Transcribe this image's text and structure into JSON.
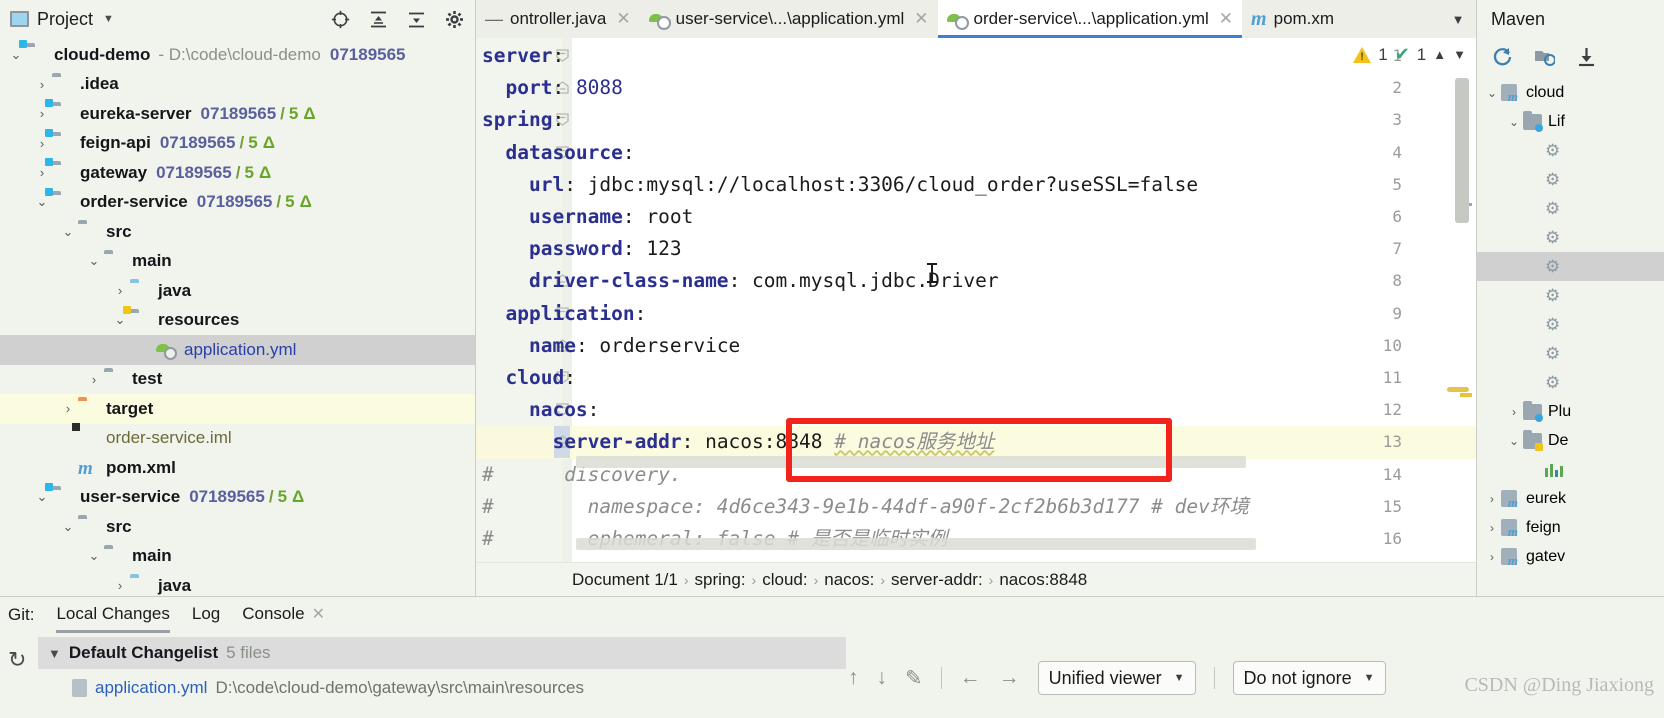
{
  "project_panel": {
    "title": "Project",
    "icons": [
      "locate-icon",
      "expand-all-icon",
      "collapse-all-icon",
      "settings-gear-icon",
      "hide-icon"
    ],
    "tree": [
      {
        "label": "cloud-demo",
        "path": "- D:\\code\\cloud-demo",
        "hash": "07189565",
        "depth": 0,
        "arrow": "expanded",
        "icon": "module-folder-icon"
      },
      {
        "label": ".idea",
        "depth": 1,
        "arrow": "collapsed",
        "icon": "folder-icon",
        "bold": false
      },
      {
        "label": "eureka-server",
        "hash": "07189565",
        "slash": "/",
        "num": "5",
        "delta": "Δ",
        "depth": 1,
        "arrow": "collapsed",
        "icon": "module-folder-icon"
      },
      {
        "label": "feign-api",
        "hash": "07189565",
        "slash": "/",
        "num": "5",
        "delta": "Δ",
        "depth": 1,
        "arrow": "collapsed",
        "icon": "module-folder-icon"
      },
      {
        "label": "gateway",
        "hash": "07189565",
        "slash": "/",
        "num": "5",
        "delta": "Δ",
        "depth": 1,
        "arrow": "collapsed",
        "icon": "module-folder-icon"
      },
      {
        "label": "order-service",
        "hash": "07189565",
        "slash": "/",
        "num": "5",
        "delta": "Δ",
        "depth": 1,
        "arrow": "expanded",
        "icon": "module-folder-icon"
      },
      {
        "label": "src",
        "depth": 2,
        "arrow": "expanded",
        "icon": "folder-icon"
      },
      {
        "label": "main",
        "depth": 3,
        "arrow": "expanded",
        "icon": "folder-icon"
      },
      {
        "label": "java",
        "depth": 4,
        "arrow": "collapsed",
        "icon": "sources-folder-icon"
      },
      {
        "label": "resources",
        "depth": 4,
        "arrow": "expanded",
        "icon": "resources-folder-icon"
      },
      {
        "label": "application.yml",
        "depth": 5,
        "arrow": "none",
        "icon": "spring-yaml-icon",
        "selected": true
      },
      {
        "label": "test",
        "depth": 3,
        "arrow": "collapsed",
        "icon": "folder-icon"
      },
      {
        "label": "target",
        "depth": 2,
        "arrow": "collapsed",
        "icon": "excluded-folder-icon",
        "modified": true
      },
      {
        "label": "order-service.iml",
        "depth": 2,
        "arrow": "none",
        "icon": "iml-file-icon"
      },
      {
        "label": "pom.xml",
        "depth": 2,
        "arrow": "none",
        "icon": "maven-pom-icon"
      },
      {
        "label": "user-service",
        "hash": "07189565",
        "slash": "/",
        "num": "5",
        "delta": "Δ",
        "depth": 1,
        "arrow": "expanded",
        "icon": "module-folder-icon"
      },
      {
        "label": "src",
        "depth": 2,
        "arrow": "expanded",
        "icon": "folder-icon"
      },
      {
        "label": "main",
        "depth": 3,
        "arrow": "expanded",
        "icon": "folder-icon"
      },
      {
        "label": "java",
        "depth": 4,
        "arrow": "collapsed",
        "icon": "sources-folder-icon"
      }
    ]
  },
  "tabs": [
    {
      "label": "ontroller.java",
      "icon": "minus-icon",
      "active": false,
      "closable": true
    },
    {
      "label": "user-service\\...\\application.yml",
      "icon": "spring-yaml-icon",
      "active": false,
      "closable": true
    },
    {
      "label": "order-service\\...\\application.yml",
      "icon": "spring-yaml-icon",
      "active": true,
      "closable": true
    },
    {
      "label": "pom.xm",
      "icon": "maven-pom-icon",
      "active": false,
      "closable": false
    }
  ],
  "tab_overflow_icon": "chevron-down-icon",
  "editor": {
    "inspections": {
      "warning_count": "1",
      "check_count": "1",
      "up_icon": "chevron-up-icon",
      "down_icon": "chevron-down-icon"
    },
    "lines": [
      {
        "n": "1",
        "fold": "collapse",
        "text": "server:",
        "indent": 0,
        "key": "server",
        "kind": "key"
      },
      {
        "n": "2",
        "fold": "end",
        "text": "  port: 8088",
        "indent": 1,
        "key": "port",
        "value": "8088",
        "kind": "num"
      },
      {
        "n": "3",
        "fold": "collapse",
        "text": "spring:",
        "indent": 0,
        "key": "spring",
        "kind": "key"
      },
      {
        "n": "4",
        "fold": "collapse",
        "text": "  datasource:",
        "indent": 1,
        "key": "datasource",
        "kind": "key"
      },
      {
        "n": "5",
        "fold": "",
        "text": "    url: jdbc:mysql://localhost:3306/cloud_order?useSSL=false",
        "indent": 2,
        "key": "url",
        "value": "jdbc:mysql://localhost:3306/cloud_order?useSSL=false",
        "kind": "plain"
      },
      {
        "n": "6",
        "fold": "",
        "text": "    username: root",
        "indent": 2,
        "key": "username",
        "value": "root",
        "kind": "plain"
      },
      {
        "n": "7",
        "fold": "",
        "text": "    password: 123",
        "indent": 2,
        "key": "password",
        "value": "123",
        "kind": "plain"
      },
      {
        "n": "8",
        "fold": "end",
        "text": "    driver-class-name: com.mysql.jdbc.Driver",
        "indent": 2,
        "key": "driver-class-name",
        "value": "com.mysql.jdbc.Driver",
        "kind": "plain"
      },
      {
        "n": "9",
        "fold": "collapse",
        "text": "  application:",
        "indent": 1,
        "key": "application",
        "kind": "key"
      },
      {
        "n": "10",
        "fold": "end",
        "text": "    name: orderservice",
        "indent": 2,
        "key": "name",
        "value": "orderservice",
        "kind": "plain"
      },
      {
        "n": "11",
        "fold": "collapse",
        "text": "  cloud:",
        "indent": 1,
        "key": "cloud",
        "kind": "key"
      },
      {
        "n": "12",
        "fold": "collapse",
        "text": "    nacos:",
        "indent": 2,
        "key": "nacos",
        "kind": "key"
      },
      {
        "n": "13",
        "fold": "end",
        "text": "      server-addr: nacos:8848 # nacos服务地址",
        "indent": 3,
        "key": "server-addr",
        "value": "nacos:8848",
        "comment": "# nacos服务地址",
        "kind": "comment-tail",
        "caret": true
      },
      {
        "n": "14",
        "fold": "",
        "text": "#      discovery.",
        "indent": 0,
        "kind": "comment"
      },
      {
        "n": "15",
        "fold": "",
        "text": "#        namespace: 4d6ce343-9e1b-44df-a90f-2cf2b6b3d177 # dev环境",
        "indent": 0,
        "kind": "comment"
      },
      {
        "n": "16",
        "fold": "",
        "text": "#        ephemeral: false # 是否是临时实例",
        "indent": 0,
        "kind": "comment"
      }
    ],
    "highlight_box": {
      "color": "#f2231b",
      "label": "server-addr-highlight-box"
    }
  },
  "breadcrumb": {
    "items": [
      "Document 1/1",
      "spring:",
      "cloud:",
      "nacos:",
      "server-addr:",
      "nacos:8848"
    ],
    "separator": "›"
  },
  "maven_panel": {
    "title": "Maven",
    "toolbar_icons": [
      "reload-icon",
      "add-maven-project-icon",
      "download-sources-icon"
    ],
    "tree": [
      {
        "label": "cloud",
        "depth": 0,
        "arrow": "expanded",
        "icon": "maven-project-icon"
      },
      {
        "label": "Lif",
        "depth": 1,
        "arrow": "expanded",
        "icon": "lifecycle-folder-icon"
      },
      {
        "label": "",
        "depth": 2,
        "arrow": "none",
        "icon": "maven-goal-icon"
      },
      {
        "label": "",
        "depth": 2,
        "arrow": "none",
        "icon": "maven-goal-icon"
      },
      {
        "label": "",
        "depth": 2,
        "arrow": "none",
        "icon": "maven-goal-icon"
      },
      {
        "label": "",
        "depth": 2,
        "arrow": "none",
        "icon": "maven-goal-icon"
      },
      {
        "label": "",
        "depth": 2,
        "arrow": "none",
        "icon": "maven-goal-icon",
        "selected": true
      },
      {
        "label": "",
        "depth": 2,
        "arrow": "none",
        "icon": "maven-goal-icon"
      },
      {
        "label": "",
        "depth": 2,
        "arrow": "none",
        "icon": "maven-goal-icon"
      },
      {
        "label": "",
        "depth": 2,
        "arrow": "none",
        "icon": "maven-goal-icon"
      },
      {
        "label": "",
        "depth": 2,
        "arrow": "none",
        "icon": "maven-goal-icon"
      },
      {
        "label": "Plu",
        "depth": 1,
        "arrow": "collapsed",
        "icon": "plugins-folder-icon"
      },
      {
        "label": "De",
        "depth": 1,
        "arrow": "expanded",
        "icon": "dependencies-folder-icon"
      },
      {
        "label": "",
        "depth": 2,
        "arrow": "none",
        "icon": "dependency-icon"
      },
      {
        "label": "eurek",
        "depth": 0,
        "arrow": "collapsed",
        "icon": "maven-project-icon"
      },
      {
        "label": "feign",
        "depth": 0,
        "arrow": "collapsed",
        "icon": "maven-project-icon"
      },
      {
        "label": "gatev",
        "depth": 0,
        "arrow": "collapsed",
        "icon": "maven-project-icon"
      }
    ]
  },
  "git_panel": {
    "label": "Git:",
    "tabs": [
      {
        "label": "Local Changes",
        "active": true,
        "closable": false
      },
      {
        "label": "Log",
        "active": false,
        "closable": false
      },
      {
        "label": "Console",
        "active": false,
        "closable": true
      }
    ],
    "refresh_icon": "refresh-icon",
    "changelist": {
      "name": "Default Changelist",
      "count": "5 files",
      "arrow": "expanded"
    },
    "files": [
      {
        "name": "application.yml",
        "path": "D:\\code\\cloud-demo\\gateway\\src\\main\\resources"
      }
    ],
    "diff_toolbar": {
      "icons": [
        "prev-change-up-icon",
        "next-change-down-icon",
        "edit-pencil-icon",
        "prev-diff-left-icon",
        "next-diff-right-icon"
      ],
      "viewer_select": {
        "value": "Unified viewer",
        "caret": "▾"
      },
      "whitespace_select": {
        "value": "Do not ignore",
        "caret": "▾"
      }
    }
  },
  "watermark": "CSDN @Ding Jiaxiong",
  "colors": {
    "accent": "#3d7fd0",
    "highlight_red": "#f2231b",
    "selection_gray": "#d0d0d0",
    "modified_yellow": "#fbfbdf",
    "keyword_blue": "#2b2f8f",
    "comment_gray": "#8c8c8c",
    "hash_violet": "#5a5f9e",
    "green": "#6aa52b"
  }
}
